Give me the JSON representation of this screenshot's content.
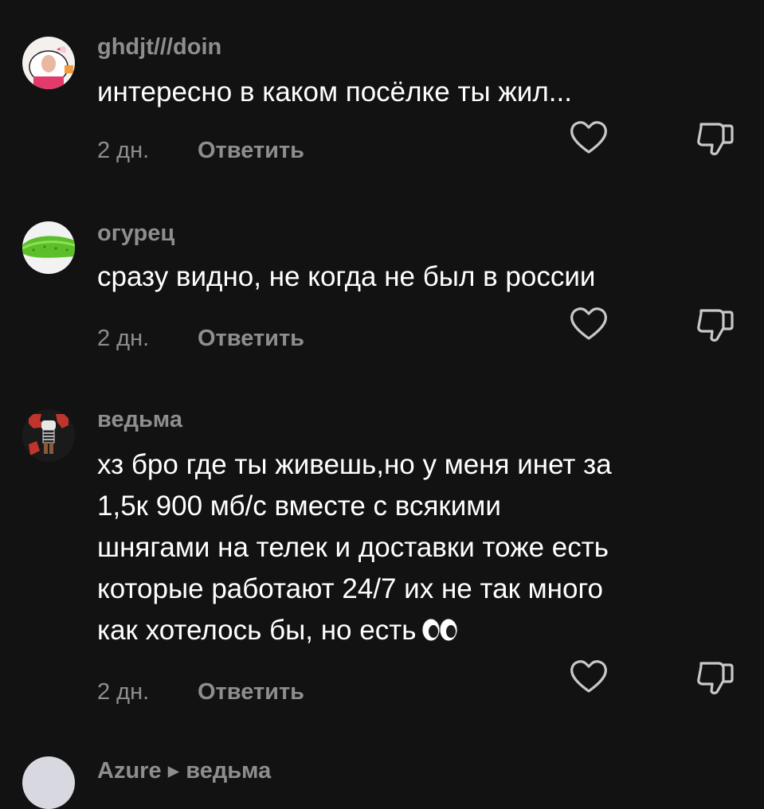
{
  "comments": [
    {
      "username": "ghdjt///doin",
      "avatar_icon": "hello-kitty-avatar",
      "lines": [
        "интересно в каком посёлке ты жил..."
      ],
      "time": "2 дн.",
      "reply_label": "Ответить"
    },
    {
      "username": "огурец",
      "avatar_icon": "cucumber-avatar",
      "lines": [
        "сразу видно, не когда не был в россии"
      ],
      "time": "2 дн.",
      "reply_label": "Ответить"
    },
    {
      "username": "ведьма",
      "avatar_icon": "game-character-avatar",
      "lines": [
        "хз бро где ты живешь,но у меня инет за",
        "1,5к 900 мб/с вместе с всякими",
        "шнягами на телек и доставки тоже есть",
        "которые работают 24/7 их не так много",
        "как хотелось бы, но есть"
      ],
      "time": "2 дн.",
      "reply_label": "Ответить"
    }
  ],
  "next_comment": {
    "username": "Azure ▸ ведьма"
  },
  "colors": {
    "background": "#121212",
    "text_primary": "#ffffff",
    "text_secondary": "#8e8e8e"
  }
}
